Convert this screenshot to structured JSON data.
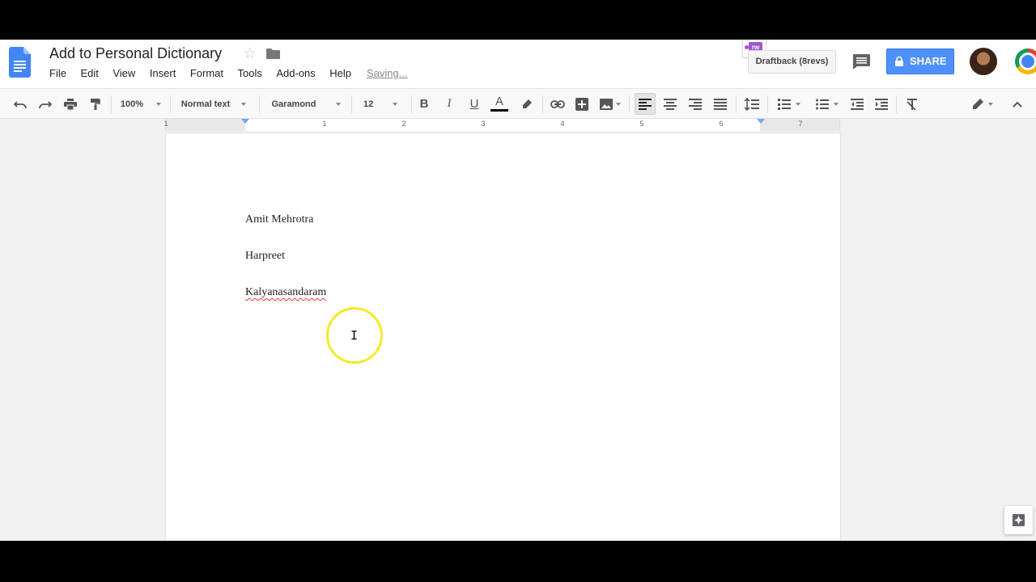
{
  "header": {
    "title": "Add to Personal Dictionary",
    "saving_status": "Saving...",
    "menu": [
      "File",
      "Edit",
      "View",
      "Insert",
      "Format",
      "Tools",
      "Add-ons",
      "Help"
    ],
    "extension_badge": "rw",
    "draftback_label": "Draftback (8revs)",
    "share_label": "SHARE"
  },
  "toolbar": {
    "zoom": "100%",
    "style": "Normal text",
    "font": "Garamond",
    "font_size": "12",
    "bold": "B",
    "italic": "I",
    "underline": "U",
    "text_color_letter": "A"
  },
  "ruler": {
    "numbers": [
      "1",
      "1",
      "2",
      "3",
      "4",
      "5",
      "6",
      "7"
    ]
  },
  "document": {
    "paragraphs": [
      "Amit Mehrotra",
      "Harpreet",
      "Kalyanasandaram"
    ]
  },
  "colors": {
    "accent": "#4d90fe",
    "docs_blue": "#4285f4",
    "cursor_highlight": "#f2ea2a",
    "spell_error": "#ee3333"
  }
}
